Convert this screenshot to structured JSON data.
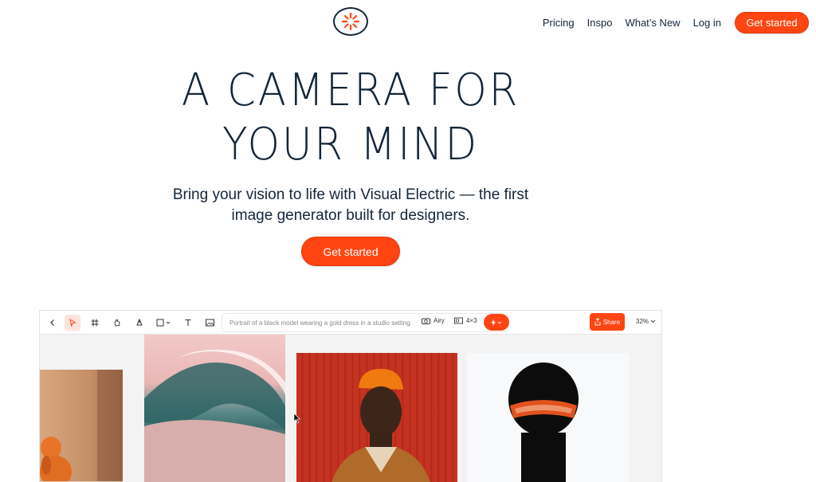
{
  "nav": {
    "logo_icon": "sunburst-logo-icon",
    "links": [
      "Pricing",
      "Inspo",
      "What’s New",
      "Log in"
    ],
    "cta": "Get started"
  },
  "hero": {
    "title_line1": "A CAMERA FOR",
    "title_line2": "YOUR MIND",
    "subtitle": "Bring your vision to life with Visual Electric — the first image generator built for designers.",
    "cta": "Get started"
  },
  "app": {
    "toolbar": {
      "tools": [
        "back-icon",
        "select-icon",
        "frame-icon",
        "hand-icon",
        "pen-icon",
        "shape-icon",
        "text-icon",
        "image-icon"
      ],
      "prompt": "Portrait of a black model wearing a gold dress in a studio setting",
      "style_label": "Airy",
      "aspect_label": "4×3",
      "share_label": "Share",
      "zoom_label": "32%"
    }
  },
  "colors": {
    "accent": "#ff4512",
    "text": "#13263a"
  }
}
